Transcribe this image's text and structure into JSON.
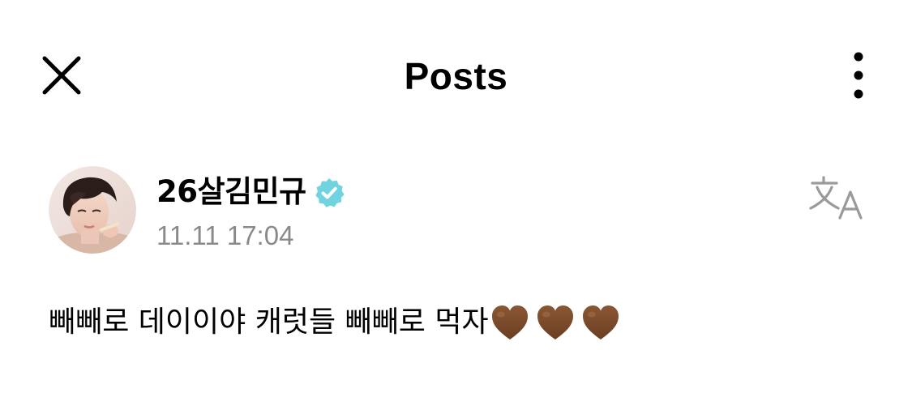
{
  "header": {
    "title": "Posts",
    "close_icon": "close-icon",
    "more_icon": "more-vertical-icon"
  },
  "post": {
    "author": {
      "name": "26살김민규",
      "verified": true,
      "verified_icon": "verified-badge-icon",
      "avatar": "avatar"
    },
    "timestamp": "11.11 17:04",
    "translate_icon": "translate-icon",
    "text": "빼빼로 데이이야 캐럿들 빼빼로 먹자",
    "emojis": [
      "brown-heart",
      "brown-heart",
      "brown-heart"
    ]
  },
  "colors": {
    "verified_badge": "#6fd3e0",
    "timestamp_text": "#8a8a8a",
    "icon_gray": "#9a9a9a",
    "heart_brown": "#7a4a2a"
  }
}
